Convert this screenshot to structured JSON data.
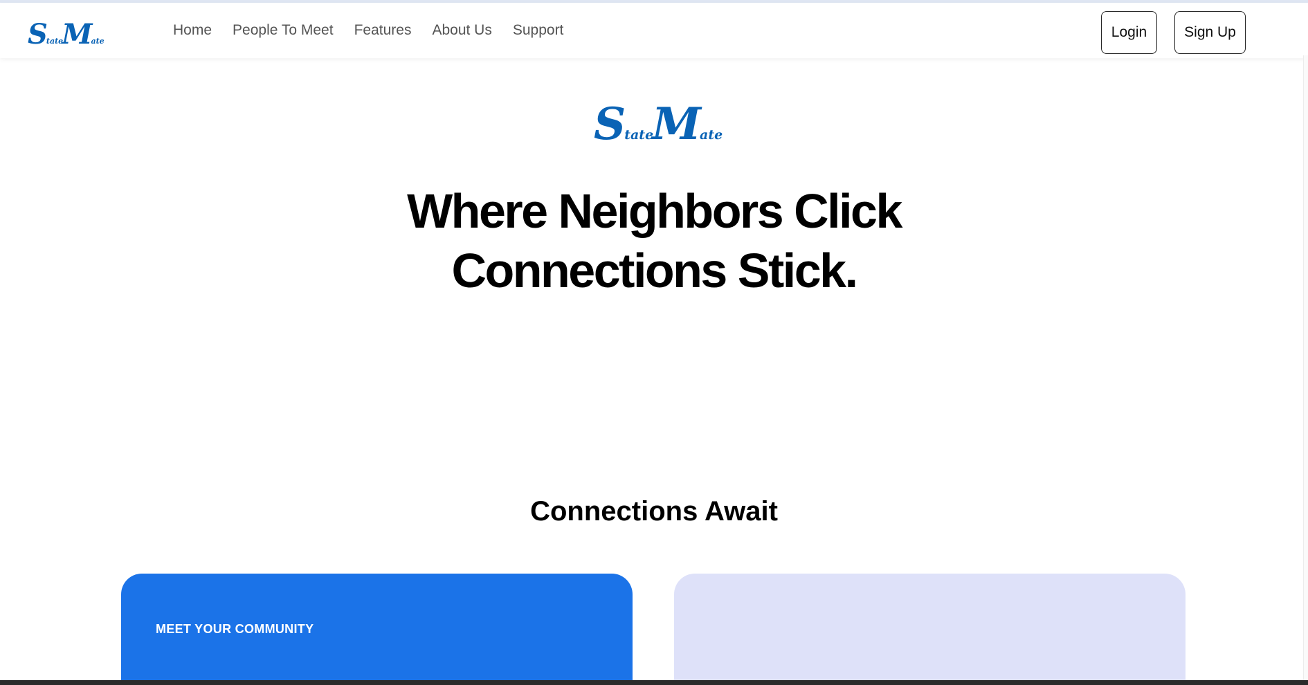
{
  "brand": {
    "logo_part1_big": "S",
    "logo_part1_small": "tate",
    "logo_part2_big": "M",
    "logo_part2_small": "ate",
    "color": "#0a63b5"
  },
  "nav": {
    "links": [
      "Home",
      "People To Meet",
      "Features",
      "About Us",
      "Support"
    ],
    "login_label": "Login",
    "signup_label": "Sign Up"
  },
  "hero": {
    "title_line1": "Where Neighbors Click",
    "title_line2": "Connections Stick."
  },
  "connections": {
    "title": "Connections Await",
    "cards": [
      {
        "label": "MEET YOUR COMMUNITY",
        "color": "#1b73e8"
      },
      {
        "label": "",
        "color": "#dee1f9"
      }
    ]
  }
}
